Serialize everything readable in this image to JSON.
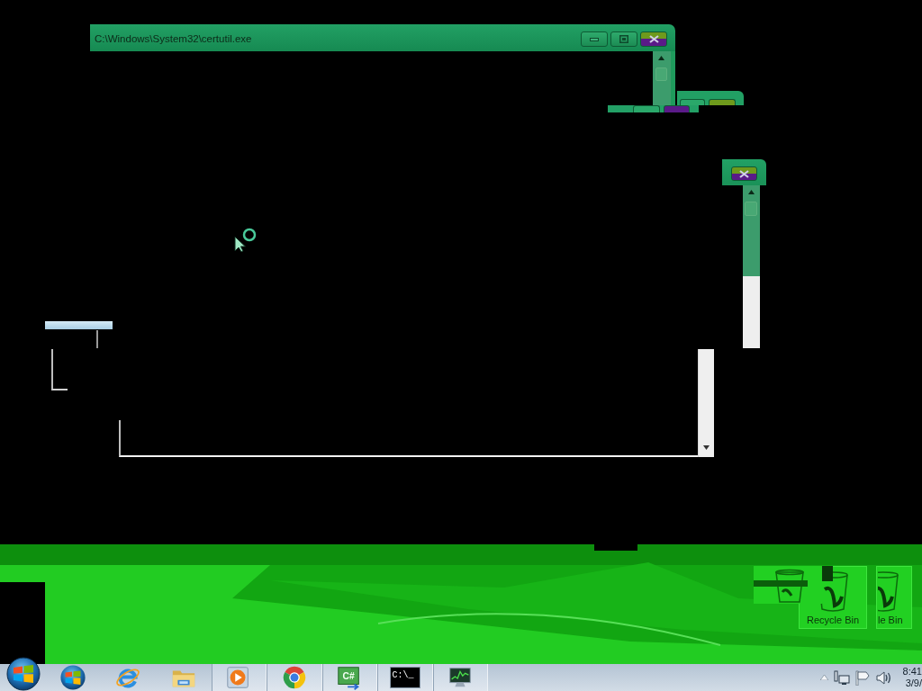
{
  "window": {
    "title": "C:\\Windows\\System32\\certutil.exe"
  },
  "desktop_icons": [
    {
      "label": "Recycle Bin",
      "selected": true
    },
    {
      "label": "le Bin",
      "selected": true
    }
  ],
  "taskbar": {
    "buttons": [
      {
        "kind": "orb",
        "running": false
      },
      {
        "kind": "browser",
        "running": false
      },
      {
        "kind": "folder",
        "running": false
      },
      {
        "kind": "player",
        "running": true
      },
      {
        "kind": "sphere",
        "running": true
      },
      {
        "kind": "code",
        "text": "C#",
        "running": true
      },
      {
        "kind": "console",
        "text": "C:\\_",
        "running": true
      },
      {
        "kind": "monitor",
        "running": true
      }
    ],
    "clock": {
      "time": "8:41",
      "date": "3/9/"
    }
  }
}
